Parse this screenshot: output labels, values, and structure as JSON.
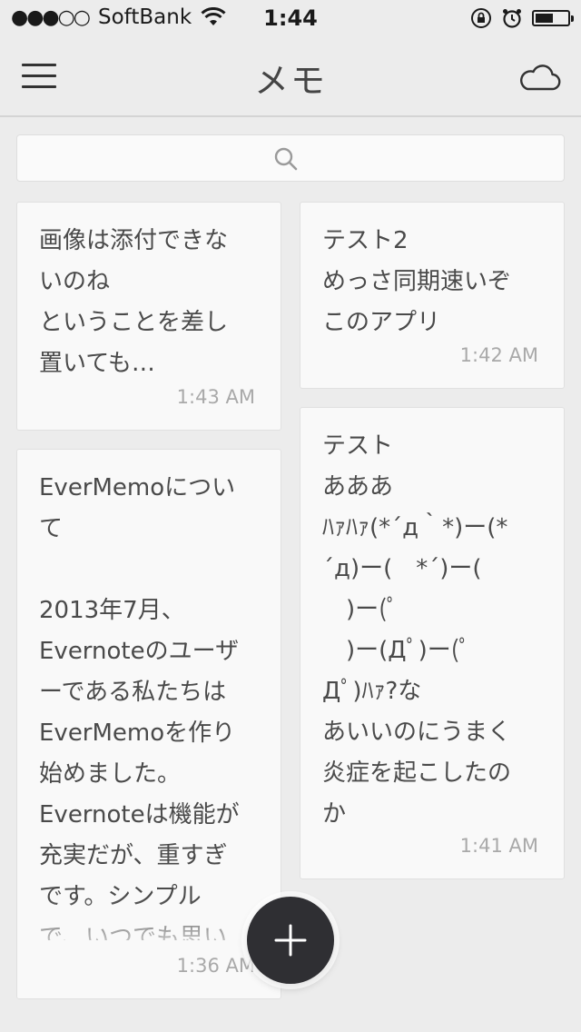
{
  "status_bar": {
    "signal": "●●●○○",
    "carrier": "SoftBank",
    "time": "1:44",
    "battery_level": 0.55
  },
  "nav": {
    "title": "メモ",
    "menu_icon": "hamburger-menu-icon",
    "cloud_icon": "cloud-icon"
  },
  "search": {
    "icon": "search-icon",
    "placeholder": ""
  },
  "notes": [
    {
      "text": "画像は添付できな\nいのね\nということを差し\n置いても…",
      "time": "1:43 AM"
    },
    {
      "text": "テスト2\nめっさ同期速いぞ\nこのアプリ",
      "time": "1:42 AM"
    },
    {
      "text": "EverMemoについ\nて\n\n2013年7月、\nEvernoteのユーザ\nーである私たちは\nEverMemoを作り\n始めました。\nEvernoteは機能が\n充実だが、重すぎ\nです。シンプル\nで、いつでも思い",
      "time": "1:36 AM"
    },
    {
      "text": "テスト\nあああ\nﾊｧﾊｧ(*´д｀*)ー(*\n´д)ー(　*´)ー(\n　)ー(ﾟ\n　)ー(Дﾟ)ー(ﾟ\nДﾟ)ﾊｧ?な\nあいいのにうまく\n炎症を起こしたの\nか",
      "time": "1:41 AM"
    }
  ],
  "fab": {
    "icon": "plus-icon"
  }
}
